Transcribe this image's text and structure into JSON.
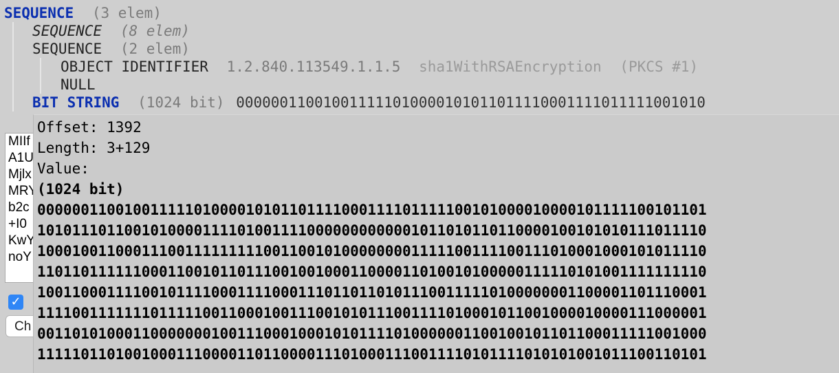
{
  "tree": {
    "row1": {
      "name": "SEQUENCE",
      "info": "(3 elem)"
    },
    "row2": {
      "name": "SEQUENCE",
      "info": "(8 elem)"
    },
    "row3": {
      "name": "SEQUENCE",
      "info": "(2 elem)"
    },
    "row4": {
      "name": "OBJECT IDENTIFIER",
      "oid": "1.2.840.113549.1.1.5",
      "oid_name": "sha1WithRSAEncryption",
      "oid_note": "(PKCS #1)"
    },
    "row5": {
      "name": "NULL"
    },
    "row6": {
      "name": "BIT STRING",
      "info": "(1024 bit)",
      "value_preview": "000000110010011111010000101011011110001111011111001010"
    }
  },
  "left_panel": {
    "text_lines": [
      "MIIf",
      "A1U",
      "Mjlx",
      "MRY",
      "b2c",
      "+I0",
      "KwY",
      "noY"
    ],
    "checkbox_checked": "✓",
    "button_label": "Ch"
  },
  "tooltip": {
    "offset_label": "Offset: 1392",
    "length_label": "Length: 3+129",
    "value_label": "Value:",
    "bit_info": "(1024 bit)",
    "bit_lines": [
      "00000011001001111101000010101101111000111101111100101000010000101111100101101",
      "10101110110010100001111010011110000000000001011010110110000100101010111011110",
      "10001001100011100111111111001100101000000001111100111100111010001000101011110",
      "11011011111100011001011011100100100011000011010010100000111110101001111111110",
      "10011000111100101111000111100011101101101011100111110100000001100001101110001",
      "11110011111110111110011000100111001010111001111010001011001000010000111000001",
      "00110101000110000000100111000100010101111010000001100100101101100011111001000",
      "11111011010010001110000110110000111010001110011110101111010101001011100110101"
    ]
  }
}
